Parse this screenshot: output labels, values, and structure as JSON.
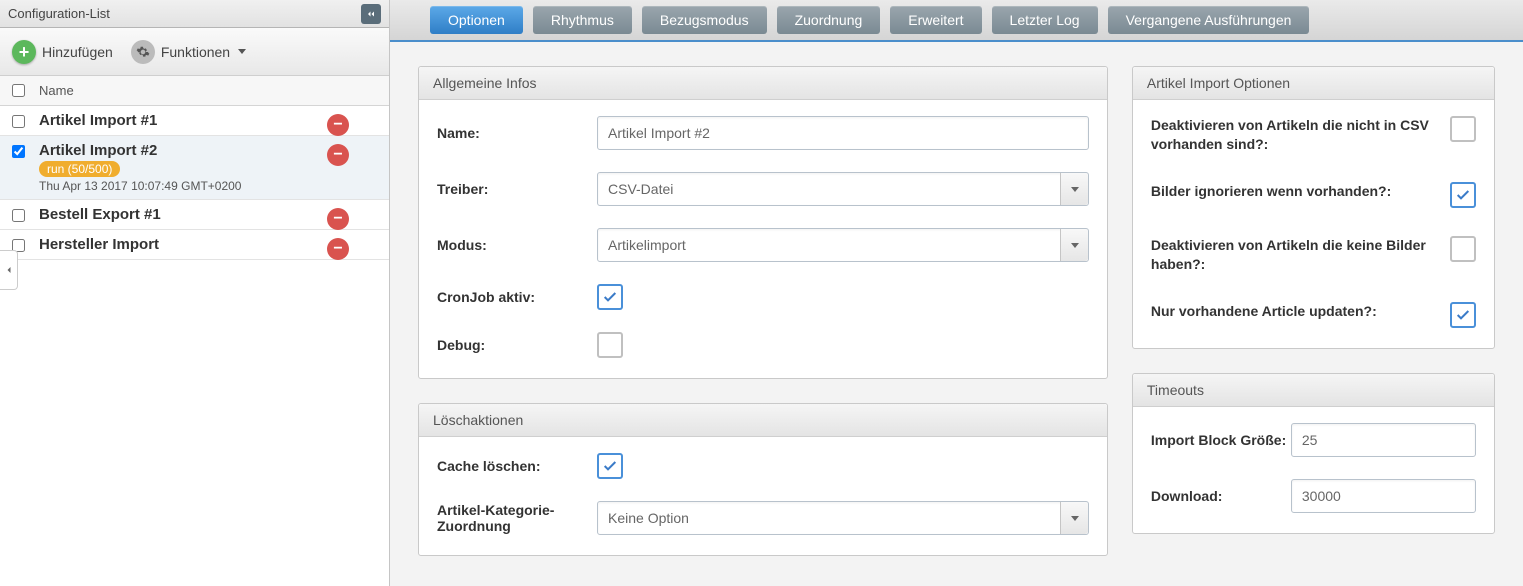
{
  "sidebar": {
    "title": "Configuration-List",
    "add_label": "Hinzufügen",
    "functions_label": "Funktionen",
    "name_header": "Name",
    "items": [
      {
        "name": "Artikel Import #1",
        "badge": "",
        "timestamp": "",
        "checked": false
      },
      {
        "name": "Artikel Import #2",
        "badge": "run (50/500)",
        "timestamp": "Thu Apr 13 2017 10:07:49 GMT+0200",
        "checked": true
      },
      {
        "name": "Bestell Export #1",
        "badge": "",
        "timestamp": "",
        "checked": false
      },
      {
        "name": "Hersteller Import",
        "badge": "",
        "timestamp": "",
        "checked": false
      }
    ]
  },
  "tabs": [
    "Optionen",
    "Rhythmus",
    "Bezugsmodus",
    "Zuordnung",
    "Erweitert",
    "Letzter Log",
    "Vergangene Ausführungen"
  ],
  "active_tab": 0,
  "panels": {
    "general": {
      "title": "Allgemeine Infos",
      "name_label": "Name:",
      "name_value": "Artikel Import #2",
      "driver_label": "Treiber:",
      "driver_value": "CSV-Datei",
      "mode_label": "Modus:",
      "mode_value": "Artikelimport",
      "cron_label": "CronJob aktiv:",
      "cron_checked": true,
      "debug_label": "Debug:",
      "debug_checked": false
    },
    "delete": {
      "title": "Löschaktionen",
      "cache_label": "Cache löschen:",
      "cache_checked": true,
      "catmap_label": "Artikel-Kategorie-Zuordnung",
      "catmap_value": "Keine Option"
    },
    "import_options": {
      "title": "Artikel Import Optionen",
      "opt1_label": "Deaktivieren von Artikeln die nicht in CSV vorhanden sind?:",
      "opt1_checked": false,
      "opt2_label": "Bilder ignorieren wenn vorhanden?:",
      "opt2_checked": true,
      "opt3_label": "Deaktivieren von Artikeln die keine Bilder haben?:",
      "opt3_checked": false,
      "opt4_label": "Nur vorhandene Article updaten?:",
      "opt4_checked": true
    },
    "timeouts": {
      "title": "Timeouts",
      "block_label": "Import Block Größe:",
      "block_value": "25",
      "download_label": "Download:",
      "download_value": "30000"
    }
  }
}
